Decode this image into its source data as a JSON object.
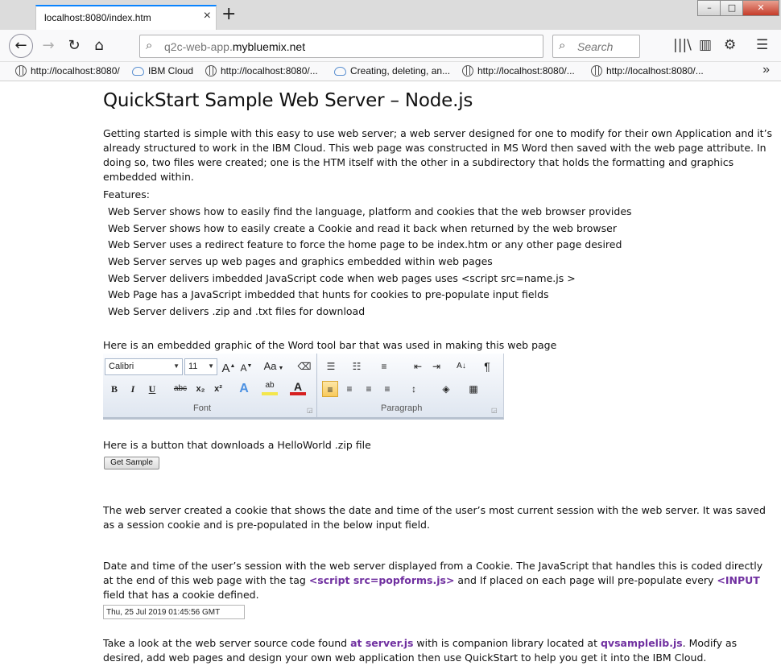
{
  "browser": {
    "tab_title": "localhost:8080/index.htm",
    "tab_close": "×",
    "new_tab": "+",
    "url_prefix": "q2c-web-app.",
    "url_domain": "mybluemix.net",
    "search_placeholder": "Search",
    "window_controls": {
      "minimize": "–",
      "maximize": "□",
      "close": "✕"
    }
  },
  "bookmarks": [
    {
      "label": "http://localhost:8080/",
      "icon": "globe-icon"
    },
    {
      "label": "IBM Cloud",
      "icon": "cloud-icon"
    },
    {
      "label": "http://localhost:8080/...",
      "icon": "globe-icon"
    },
    {
      "label": "Creating, deleting, an...",
      "icon": "cloud-icon"
    },
    {
      "label": "http://localhost:8080/...",
      "icon": "globe-icon"
    },
    {
      "label": "http://localhost:8080/...",
      "icon": "globe-icon"
    }
  ],
  "page": {
    "title": "QuickStart Sample Web Server – Node.js",
    "intro": "Getting started is simple with this easy to use web server; a web server designed for one to modify for their own Application and it’s already structured to work in the IBM Cloud.   This web page was constructed in MS Word then saved with the web page attribute.   In doing so, two files were created; one is the HTM itself with the other in a subdirectory that holds the formatting and graphics embedded within.",
    "features_heading": "Features:",
    "features": [
      "Web Server shows how to easily find the language, platform and cookies that the web browser provides",
      "Web Server shows how to easily create a Cookie and read it back when returned by the web browser",
      "Web Server uses a redirect feature to force the home page to be index.htm or any other page desired",
      "Web Server serves up web pages and graphics embedded within web pages",
      "Web Server delivers imbedded JavaScript code when web pages uses  <script src=name.js >",
      "Web Page has a JavaScript imbedded that hunts for cookies to pre-populate input fields",
      "Web Server delivers .zip and .txt files for download"
    ],
    "graphic_intro": "Here is an embedded graphic of the Word tool bar that was used in making this web page",
    "button_intro": "Here is a button that downloads a HelloWorld .zip file",
    "button_label": "Get Sample",
    "cookie_para": "The web server created a cookie that shows the date and time of the user’s most current session with the web server.  It was saved as a session cookie and is pre-populated in the below input field.",
    "date_para_a": "Date and time of the user’s session with the web server displayed from a Cookie.  The JavaScript that handles this is coded directly at the end of this web page with the tag ",
    "date_para_tag1": "<script src=popforms.js>",
    "date_para_b": "  and If placed on each page will pre-populate every ",
    "date_para_tag2": "<INPUT",
    "date_para_c": " field that has a cookie defined.",
    "cookie_value": "Thu, 25 Jul 2019 01:45:56 GMT",
    "source_a": "Take a look at the web server source code found ",
    "source_link1": "at server.js",
    "source_b": " with is companion library located at ",
    "source_link2": "qvsamplelib.js",
    "source_c": ".  Modify as desired, add web pages and design your own web application then use QuickStart to help you get it into the IBM Cloud."
  },
  "ribbon": {
    "font_name": "Calibri",
    "font_size": "11",
    "font_group_label": "Font",
    "paragraph_group_label": "Paragraph",
    "bold": "B",
    "italic": "I",
    "underline": "U",
    "strike": "abc",
    "subscript": "x₂",
    "superscript": "x²",
    "change_case": "Aa",
    "grow": "A",
    "shrink": "A",
    "pilcrow": "¶",
    "sort": "A↓"
  }
}
